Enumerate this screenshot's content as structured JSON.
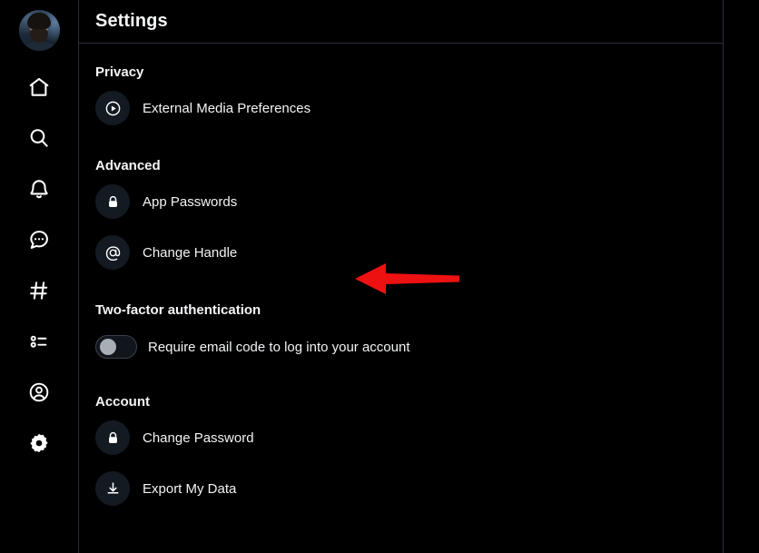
{
  "sidebar": {
    "avatar": {
      "icon": "user-avatar-photo",
      "alt": "Profile avatar"
    },
    "items": [
      {
        "icon": "home-icon",
        "name": "home"
      },
      {
        "icon": "search-icon",
        "name": "search"
      },
      {
        "icon": "bell-icon",
        "name": "notifications"
      },
      {
        "icon": "chat-bubble-icon",
        "name": "chat"
      },
      {
        "icon": "hashtag-icon",
        "name": "feeds"
      },
      {
        "icon": "list-icon",
        "name": "lists"
      },
      {
        "icon": "profile-circle-icon",
        "name": "profile"
      },
      {
        "icon": "gear-icon",
        "name": "settings"
      }
    ]
  },
  "header": {
    "title": "Settings"
  },
  "settings": {
    "sections": [
      {
        "title": "Privacy",
        "rows": [
          {
            "label": "External Media Preferences",
            "icon": "play-circle-icon",
            "type": "link"
          }
        ]
      },
      {
        "title": "Advanced",
        "rows": [
          {
            "label": "App Passwords",
            "icon": "lock-icon",
            "type": "link"
          },
          {
            "label": "Change Handle",
            "icon": "at-sign-icon",
            "type": "link"
          }
        ]
      },
      {
        "title": "Two-factor authentication",
        "rows": [
          {
            "label": "Require email code to log into your account",
            "icon": "toggle-switch",
            "type": "toggle",
            "value": "off"
          }
        ]
      },
      {
        "title": "Account",
        "rows": [
          {
            "label": "Change Password",
            "icon": "lock-icon",
            "type": "link"
          },
          {
            "label": "Export My Data",
            "icon": "download-icon",
            "type": "link"
          }
        ]
      }
    ]
  },
  "annotation": {
    "arrow": {
      "icon": "arrow-left-pointer",
      "color": "#ee1111",
      "direction": "left",
      "points_to": "Change Handle"
    }
  },
  "colors": {
    "background": "#000000",
    "border": "#2a2e37",
    "text": "#f1f3f5",
    "icon_circle": "#141a22",
    "toggle_knob": "#a9aeb5",
    "annotation_red": "#ee1111"
  }
}
